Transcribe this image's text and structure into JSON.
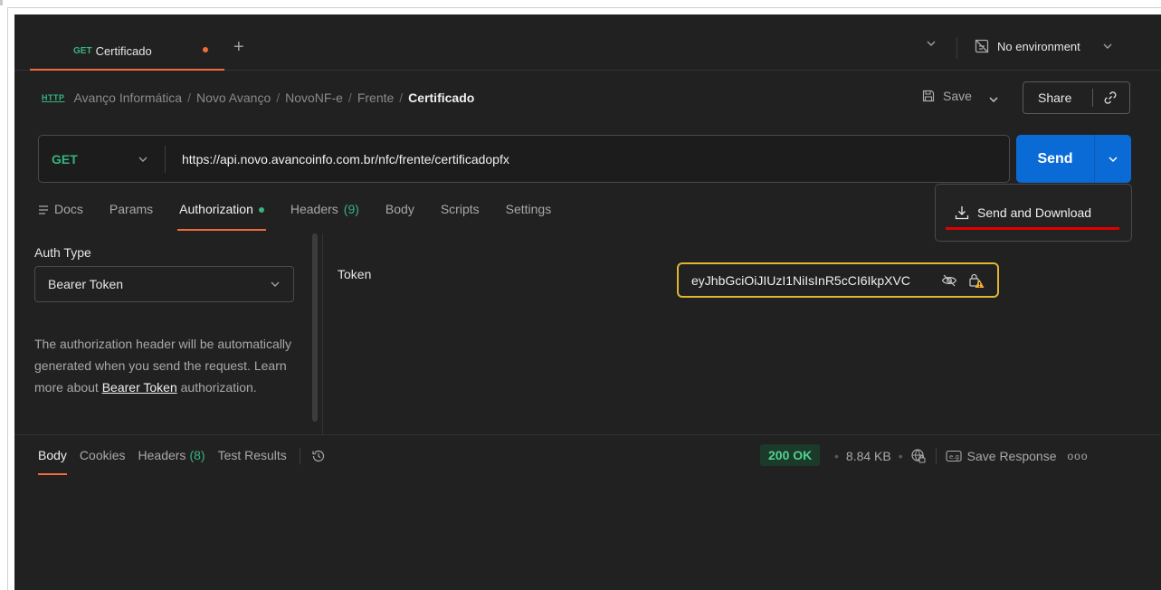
{
  "tab": {
    "method": "GET",
    "name": "Certificado",
    "new_tab_glyph": "+"
  },
  "environment": {
    "label": "No environment"
  },
  "breadcrumb": {
    "badge": "HTTP",
    "parts": [
      "Avanço Informática",
      "Novo Avanço",
      "NovoNF-e",
      "Frente"
    ],
    "separator": "/",
    "current": "Certificado"
  },
  "toolbar": {
    "save_label": "Save",
    "share_label": "Share"
  },
  "request": {
    "method": "GET",
    "url": "https://api.novo.avancoinfo.com.br/nfc/frente/certificadopfx",
    "send_label": "Send"
  },
  "request_tabs": [
    {
      "label": "Docs"
    },
    {
      "label": "Params"
    },
    {
      "label": "Authorization"
    },
    {
      "label": "Headers",
      "count": "(9)"
    },
    {
      "label": "Body"
    },
    {
      "label": "Scripts"
    },
    {
      "label": "Settings"
    }
  ],
  "send_menu": {
    "item": "Send and Download"
  },
  "auth": {
    "title": "Auth Type",
    "type": "Bearer Token",
    "desc_prefix": "The authorization header will be automatically generated when you send the request. Learn more about ",
    "desc_link": "Bearer Token",
    "desc_suffix": " authorization.",
    "token_label": "Token",
    "token_value": "eyJhbGciOiJIUzI1NiIsInR5cCI6IkpXVC"
  },
  "response_tabs": [
    {
      "label": "Body"
    },
    {
      "label": "Cookies"
    },
    {
      "label": "Headers",
      "count": "(8)"
    },
    {
      "label": "Test Results"
    }
  ],
  "response": {
    "status": "200 OK",
    "size": "8.84 KB",
    "save_label": "Save Response",
    "more": "ooo"
  },
  "colors": {
    "accent": "#f26b3a",
    "method_green": "#36b37e",
    "send_blue": "#0b6bd6",
    "token_border": "#e0b530",
    "annotation_red": "#e00000"
  },
  "icons": [
    "chevron-down-icon",
    "no-environment-icon",
    "save-icon",
    "link-icon",
    "download-icon",
    "docs-icon",
    "eye-slash-icon",
    "lock-warning-icon",
    "history-icon",
    "globe-lock-icon",
    "example-icon",
    "more-icon"
  ]
}
